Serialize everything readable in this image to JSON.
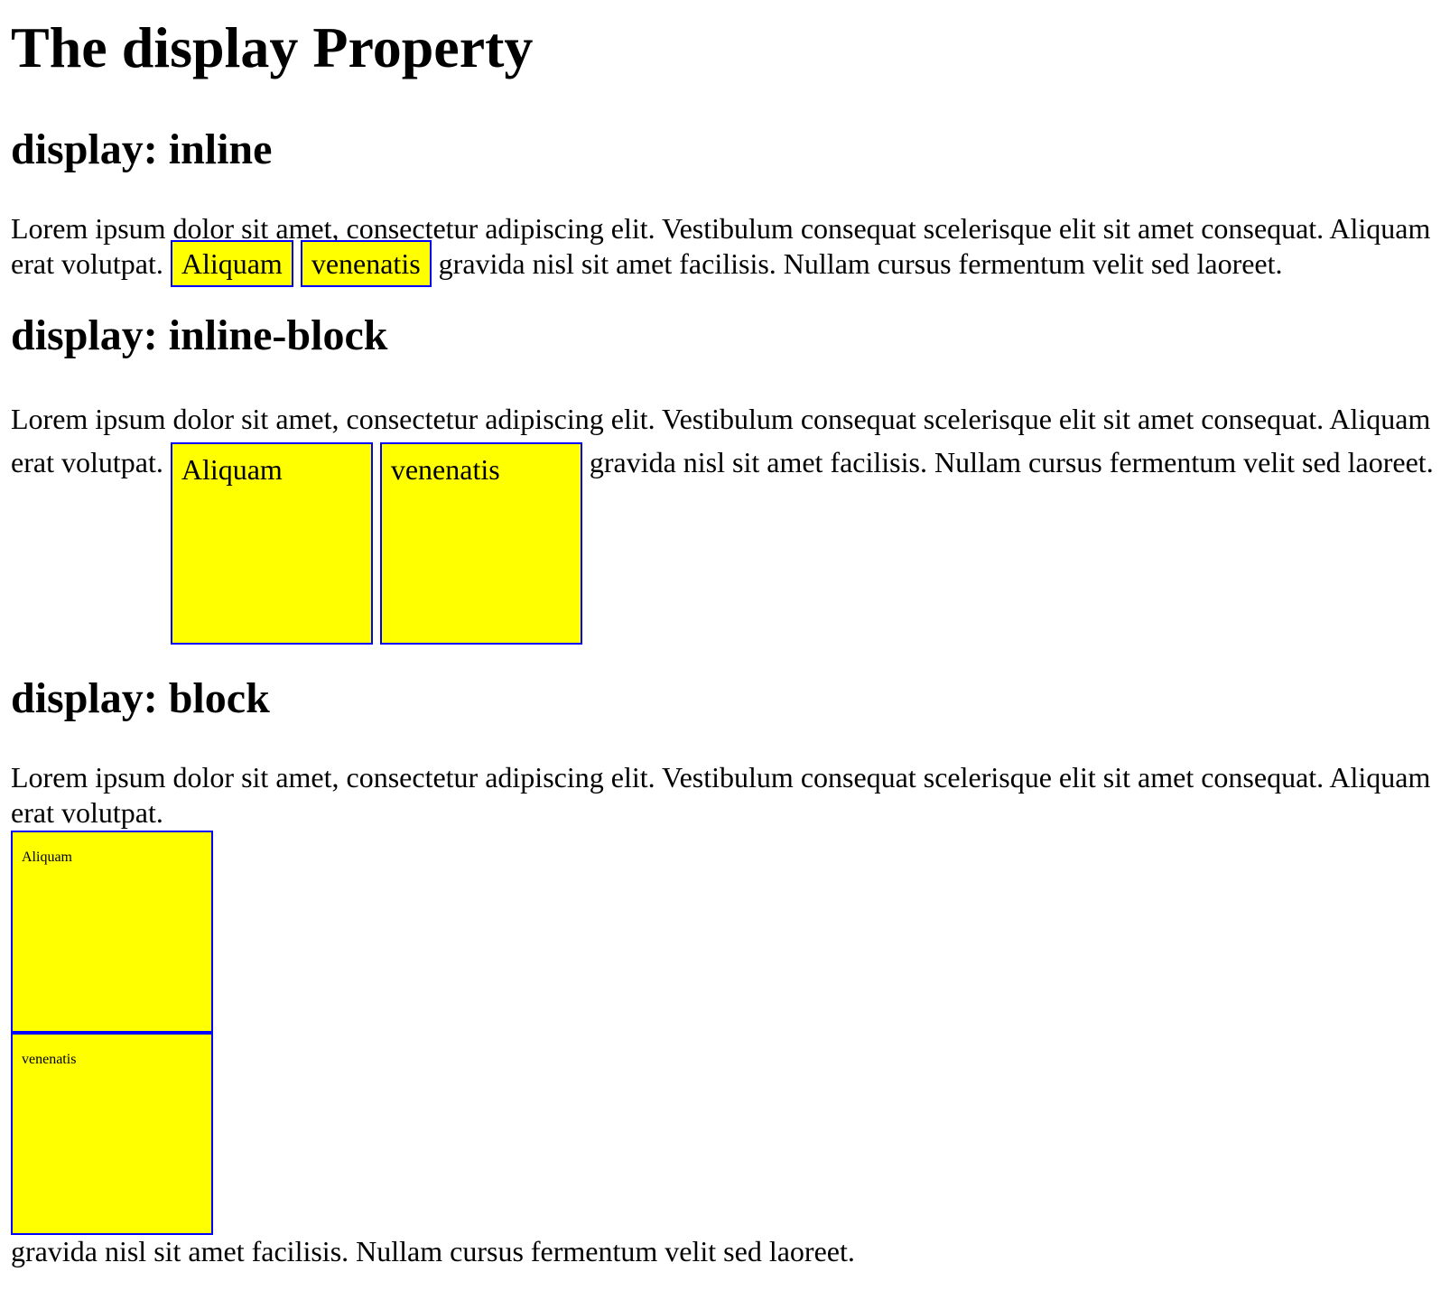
{
  "page": {
    "title": "The display Property"
  },
  "sections": [
    {
      "heading": "display: inline",
      "text_before": "Lorem ipsum dolor sit amet, consectetur adipiscing elit. Vestibulum consequat scelerisque elit sit amet consequat. Aliquam erat volutpat.",
      "box1": "Aliquam",
      "box2": "venenatis",
      "text_after": "gravida nisl sit amet facilisis. Nullam cursus fermentum velit sed laoreet."
    },
    {
      "heading": "display: inline-block",
      "text_before": "Lorem ipsum dolor sit amet, consectetur adipiscing elit. Vestibulum consequat scelerisque elit sit amet consequat. Aliquam erat volutpat.",
      "box1": "Aliquam",
      "box2": "venenatis",
      "text_after": "gravida nisl sit amet facilisis. Nullam cursus fermentum velit sed laoreet."
    },
    {
      "heading": "display: block",
      "text_before": "Lorem ipsum dolor sit amet, consectetur adipiscing elit. Vestibulum consequat scelerisque elit sit amet consequat. Aliquam erat volutpat.",
      "box1": "Aliquam",
      "box2": "venenatis",
      "text_after": "gravida nisl sit amet facilisis. Nullam cursus fermentum velit sed laoreet."
    }
  ],
  "colors": {
    "box_background": "#ffff00",
    "box_border": "#0000ff",
    "text": "#000000",
    "page_background": "#ffffff"
  }
}
